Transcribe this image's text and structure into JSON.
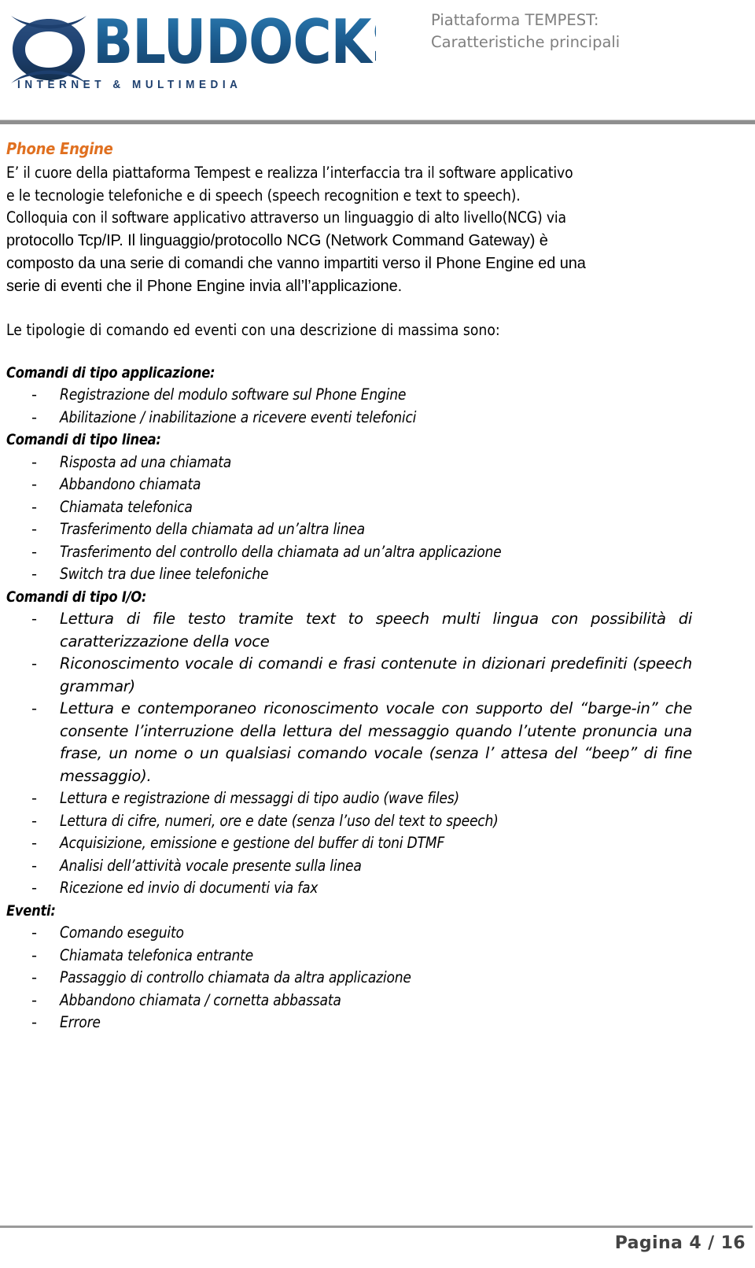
{
  "header": {
    "logo": {
      "wordmark": "BLUDOCKS",
      "tagline": "INTERNET & MULTIMEDIA",
      "mark_icon": "bludocks-spiral-logo-icon",
      "brand_color": "#1d3f6e",
      "accent_color": "#2a7ab0"
    },
    "title_line1": "Piattaforma TEMPEST:",
    "title_line2": "Caratteristiche principali",
    "title_color": "#7f7f7f",
    "rule_color": "#8f8f8f"
  },
  "content": {
    "section_title": "Phone Engine",
    "section_title_color": "#e07020",
    "intro_lines": [
      "E’ il cuore della piattaforma Tempest e realizza l’interfaccia tra il  software applicativo",
      "e le tecnologie telefoniche e di speech (speech recognition e text to speech).",
      "Colloquia con il software applicativo attraverso un linguaggio di alto livello(NCG) via"
    ],
    "ncg_lines": [
      "protocollo Tcp/IP.   Il linguaggio/protocollo NCG (Network Command Gateway) è",
      "composto da una serie di comandi che vanno impartiti verso il Phone Engine ed una",
      "serie di eventi che il Phone Engine invia all’l’applicazione."
    ],
    "lead_in": "Le tipologie di comando ed eventi con una descrizione di massima sono:",
    "groups": [
      {
        "heading": "Comandi di tipo applicazione:",
        "items": [
          {
            "text": "Registrazione del modulo software sul Phone Engine",
            "wrap": false
          },
          {
            "text": "Abilitazione / inabilitazione a ricevere eventi telefonici",
            "wrap": false
          }
        ]
      },
      {
        "heading": "Comandi di tipo linea:",
        "items": [
          {
            "text": "Risposta ad una chiamata",
            "wrap": false
          },
          {
            "text": "Abbandono chiamata",
            "wrap": false
          },
          {
            "text": "Chiamata telefonica",
            "wrap": false
          },
          {
            "text": "Trasferimento della chiamata ad un’altra linea",
            "wrap": false
          },
          {
            "text": "Trasferimento del controllo della chiamata ad un’altra applicazione",
            "wrap": false
          },
          {
            "text": "Switch tra due linee telefoniche",
            "wrap": false
          }
        ]
      },
      {
        "heading": "Comandi di tipo I/O:",
        "items": [
          {
            "text": "Lettura di file testo tramite text to speech multi lingua con possibilità di caratterizzazione della voce",
            "wrap": true
          },
          {
            "text": "Riconoscimento vocale di comandi e frasi contenute in dizionari predefiniti (speech grammar)",
            "wrap": true
          },
          {
            "text": "Lettura e contemporaneo riconoscimento vocale con supporto del “barge-in” che consente l’interruzione della lettura del messaggio quando l’utente pronuncia una frase, un nome o un qualsiasi comando vocale (senza l’ attesa del “beep” di fine messaggio).",
            "wrap": true
          },
          {
            "text": "Lettura e registrazione di messaggi di tipo audio (wave files)",
            "wrap": false
          },
          {
            "text": "Lettura di cifre, numeri, ore e date (senza l’uso del text to speech)",
            "wrap": false
          },
          {
            "text": "Acquisizione, emissione e gestione del buffer di toni DTMF",
            "wrap": false
          },
          {
            "text": "Analisi dell’attività vocale presente sulla linea",
            "wrap": false
          },
          {
            "text": "Ricezione ed invio di documenti via fax",
            "wrap": false
          }
        ]
      },
      {
        "heading": "Eventi:",
        "items": [
          {
            "text": "Comando eseguito",
            "wrap": false
          },
          {
            "text": "Chiamata telefonica entrante",
            "wrap": false
          },
          {
            "text": "Passaggio di controllo chiamata da altra applicazione",
            "wrap": false
          },
          {
            "text": "Abbandono chiamata / cornetta abbassata",
            "wrap": false
          },
          {
            "text": "Errore",
            "wrap": false
          }
        ]
      }
    ],
    "bullet_dash": "-"
  },
  "footer": {
    "page_label": "Pagina 4 / 16",
    "rule_color": "#9a9a9a"
  }
}
